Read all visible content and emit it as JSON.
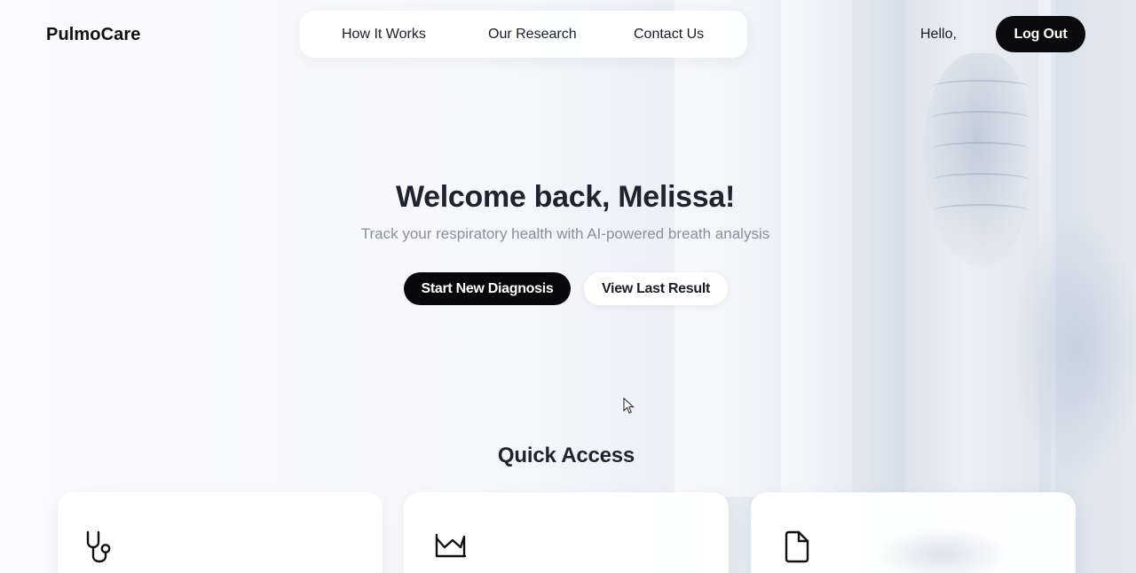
{
  "app": {
    "brand": "PulmoCare"
  },
  "nav": {
    "items": [
      {
        "label": "How It Works"
      },
      {
        "label": "Our Research"
      },
      {
        "label": "Contact Us"
      }
    ]
  },
  "user": {
    "greeting": "Hello,",
    "logout_label": "Log Out"
  },
  "hero": {
    "title": "Welcome back, Melissa!",
    "subtitle": "Track your respiratory health with AI-powered breath analysis",
    "primary_label": "Start New Diagnosis",
    "secondary_label": "View Last Result"
  },
  "quick_access": {
    "title": "Quick Access",
    "cards": [
      {
        "icon": "stethoscope-icon"
      },
      {
        "icon": "chart-icon"
      },
      {
        "icon": "document-icon"
      }
    ]
  },
  "colors": {
    "primary_button": "#08080a",
    "text": "#1e2330",
    "muted_text": "#8a8f99"
  }
}
